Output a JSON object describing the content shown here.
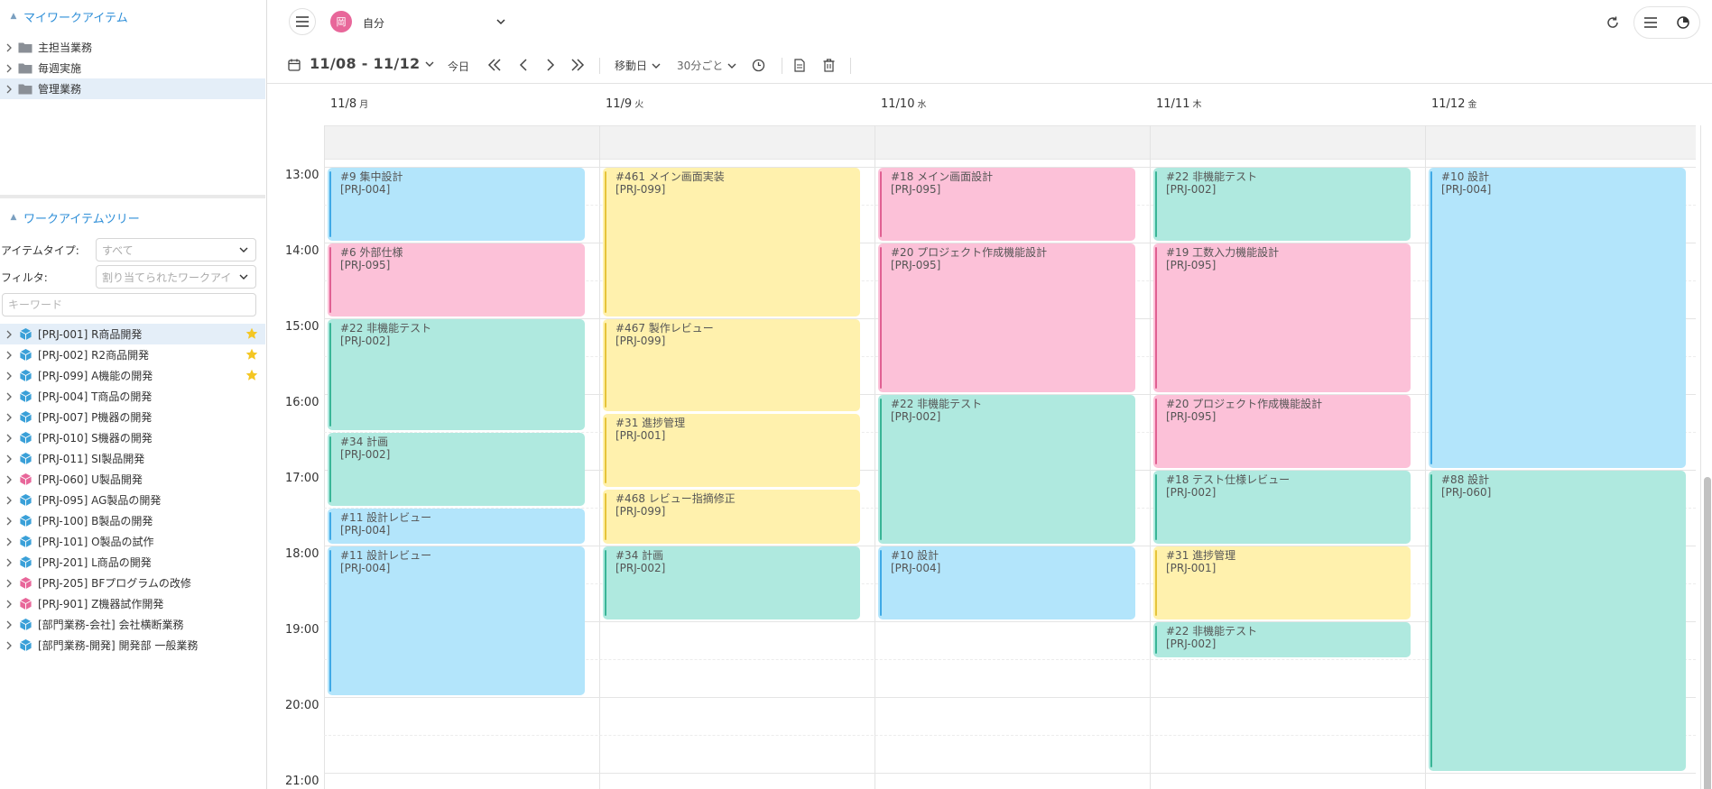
{
  "sidebar": {
    "my_work_items": {
      "title": "マイワークアイテム",
      "items": [
        {
          "label": "主担当業務"
        },
        {
          "label": "毎週実施"
        },
        {
          "label": "管理業務",
          "selected": true
        }
      ]
    },
    "work_item_tree": {
      "title": "ワークアイテムツリー",
      "item_type_label": "アイテムタイプ:",
      "item_type_value": "すべて",
      "filter_label": "フィルタ:",
      "filter_value": "割り当てられたワークアイ",
      "keyword_placeholder": "キーワード",
      "projects": [
        {
          "label": "[PRJ-001] R商品開発",
          "icon_color": "#3aa0d8",
          "starred": true,
          "selected": true
        },
        {
          "label": "[PRJ-002] R2商品開発",
          "icon_color": "#3aa0d8",
          "starred": true
        },
        {
          "label": "[PRJ-099] A機能の開発",
          "icon_color": "#3aa0d8",
          "starred": true
        },
        {
          "label": "[PRJ-004] T商品の開発",
          "icon_color": "#3aa0d8"
        },
        {
          "label": "[PRJ-007] P機器の開発",
          "icon_color": "#3aa0d8"
        },
        {
          "label": "[PRJ-010] S機器の開発",
          "icon_color": "#3aa0d8"
        },
        {
          "label": "[PRJ-011] SI製品開発",
          "icon_color": "#3aa0d8"
        },
        {
          "label": "[PRJ-060] U製品開発",
          "icon_color": "#e8679a"
        },
        {
          "label": "[PRJ-095] AG製品の開発",
          "icon_color": "#3aa0d8"
        },
        {
          "label": "[PRJ-100] B製品の開発",
          "icon_color": "#3aa0d8"
        },
        {
          "label": "[PRJ-101] O製品の試作",
          "icon_color": "#3aa0d8"
        },
        {
          "label": "[PRJ-201] L商品の開発",
          "icon_color": "#3aa0d8"
        },
        {
          "label": "[PRJ-205] BFプログラムの改修",
          "icon_color": "#e8679a"
        },
        {
          "label": "[PRJ-901] Z機器試作開発",
          "icon_color": "#e8679a"
        },
        {
          "label": "[部門業務-会社] 会社横断業務",
          "icon_color": "#3aa0d8"
        },
        {
          "label": "[部門業務-開発] 開発部 一般業務",
          "icon_color": "#3aa0d8"
        }
      ]
    }
  },
  "topbar": {
    "avatar_text": "岡",
    "user_name": "自分",
    "icons": [
      "hamburger-icon",
      "refresh-icon",
      "list-view-icon",
      "pie-chart-icon"
    ]
  },
  "toolbar": {
    "date_range": "11/08 - 11/12",
    "today_label": "今日",
    "move_unit_label": "移動日",
    "interval_label": "30分ごと"
  },
  "calendar": {
    "days": [
      {
        "date": "11/8",
        "dow": "月"
      },
      {
        "date": "11/9",
        "dow": "火"
      },
      {
        "date": "11/10",
        "dow": "水"
      },
      {
        "date": "11/11",
        "dow": "木"
      },
      {
        "date": "11/12",
        "dow": "金"
      }
    ],
    "hours": [
      "13:00",
      "14:00",
      "15:00",
      "16:00",
      "17:00",
      "18:00",
      "19:00",
      "20:00",
      "21:00"
    ],
    "colors": {
      "blue": "#b3e5fb",
      "pink": "#fcc1d8",
      "teal": "#afe9df",
      "yellow": "#fff1ad"
    },
    "bar_colors": {
      "blue": "#3fa9e6",
      "pink": "#e06092",
      "teal": "#39b596",
      "yellow": "#e6c43a"
    },
    "events": [
      {
        "day": 0,
        "start": "13:00",
        "end": "14:00",
        "title": "#9 集中設計",
        "project": "[PRJ-004]",
        "color": "blue"
      },
      {
        "day": 0,
        "start": "14:00",
        "end": "15:00",
        "title": "#6 外部仕様",
        "project": "[PRJ-095]",
        "color": "pink"
      },
      {
        "day": 0,
        "start": "15:00",
        "end": "16:30",
        "title": "#22 非機能テスト",
        "project": "[PRJ-002]",
        "color": "teal"
      },
      {
        "day": 0,
        "start": "16:30",
        "end": "17:30",
        "title": "#34 計画",
        "project": "[PRJ-002]",
        "color": "teal"
      },
      {
        "day": 0,
        "start": "17:30",
        "end": "18:00",
        "title": "#11 設計レビュー",
        "project": "[PRJ-004]",
        "color": "blue"
      },
      {
        "day": 0,
        "start": "18:00",
        "end": "20:00",
        "title": "#11 設計レビュー",
        "project": "[PRJ-004]",
        "color": "blue"
      },
      {
        "day": 1,
        "start": "13:00",
        "end": "15:00",
        "title": "#461 メイン画面実装",
        "project": "[PRJ-099]",
        "color": "yellow"
      },
      {
        "day": 1,
        "start": "15:00",
        "end": "16:15",
        "title": "#467 製作レビュー",
        "project": "[PRJ-099]",
        "color": "yellow"
      },
      {
        "day": 1,
        "start": "16:15",
        "end": "17:15",
        "title": "#31 進捗管理",
        "project": "[PRJ-001]",
        "color": "yellow"
      },
      {
        "day": 1,
        "start": "17:15",
        "end": "18:00",
        "title": "#468 レビュー指摘修正",
        "project": "[PRJ-099]",
        "color": "yellow"
      },
      {
        "day": 1,
        "start": "18:00",
        "end": "19:00",
        "title": "#34 計画",
        "project": "[PRJ-002]",
        "color": "teal"
      },
      {
        "day": 2,
        "start": "13:00",
        "end": "14:00",
        "title": "#18 メイン画面設計",
        "project": "[PRJ-095]",
        "color": "pink"
      },
      {
        "day": 2,
        "start": "14:00",
        "end": "16:00",
        "title": "#20 プロジェクト作成機能設計",
        "project": "[PRJ-095]",
        "color": "pink"
      },
      {
        "day": 2,
        "start": "16:00",
        "end": "18:00",
        "title": "#22 非機能テスト",
        "project": "[PRJ-002]",
        "color": "teal"
      },
      {
        "day": 2,
        "start": "18:00",
        "end": "19:00",
        "title": "#10 設計",
        "project": "[PRJ-004]",
        "color": "blue"
      },
      {
        "day": 3,
        "start": "13:00",
        "end": "14:00",
        "title": "#22 非機能テスト",
        "project": "[PRJ-002]",
        "color": "teal"
      },
      {
        "day": 3,
        "start": "14:00",
        "end": "16:00",
        "title": "#19 工数入力機能設計",
        "project": "[PRJ-095]",
        "color": "pink"
      },
      {
        "day": 3,
        "start": "16:00",
        "end": "17:00",
        "title": "#20 プロジェクト作成機能設計",
        "project": "[PRJ-095]",
        "color": "pink"
      },
      {
        "day": 3,
        "start": "17:00",
        "end": "18:00",
        "title": "#18 テスト仕様レビュー",
        "project": "[PRJ-002]",
        "color": "teal"
      },
      {
        "day": 3,
        "start": "18:00",
        "end": "19:00",
        "title": "#31 進捗管理",
        "project": "[PRJ-001]",
        "color": "yellow"
      },
      {
        "day": 3,
        "start": "19:00",
        "end": "19:30",
        "title": "#22 非機能テスト",
        "project": "[PRJ-002]",
        "color": "teal"
      },
      {
        "day": 4,
        "start": "13:00",
        "end": "17:00",
        "title": "#10 設計",
        "project": "[PRJ-004]",
        "color": "blue"
      },
      {
        "day": 4,
        "start": "17:00",
        "end": "21:00",
        "title": "#88 設計",
        "project": "[PRJ-060]",
        "color": "teal"
      }
    ]
  }
}
